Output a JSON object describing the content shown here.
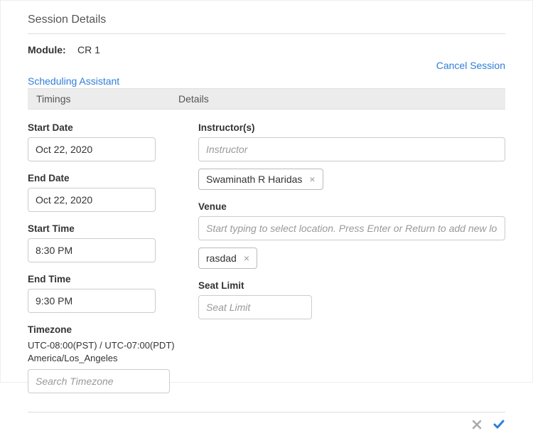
{
  "header": {
    "title": "Session Details",
    "module_label": "Module:",
    "module_value": "CR 1",
    "cancel_session": "Cancel Session",
    "scheduling_assistant": "Scheduling Assistant"
  },
  "tabs": {
    "timings": "Timings",
    "details": "Details"
  },
  "timings": {
    "start_date_label": "Start Date",
    "start_date_value": "Oct 22, 2020",
    "end_date_label": "End Date",
    "end_date_value": "Oct 22, 2020",
    "start_time_label": "Start Time",
    "start_time_value": "8:30 PM",
    "end_time_label": "End Time",
    "end_time_value": "9:30 PM",
    "timezone_label": "Timezone",
    "timezone_value": "UTC-08:00(PST) / UTC-07:00(PDT) America/Los_Angeles",
    "timezone_placeholder": "Search Timezone"
  },
  "details": {
    "instructor_label": "Instructor(s)",
    "instructor_placeholder": "Instructor",
    "instructor_chips": [
      "Swaminath R Haridas"
    ],
    "venue_label": "Venue",
    "venue_placeholder": "Start typing to select location. Press Enter or Return to add new location",
    "venue_chips": [
      "rasdad"
    ],
    "seat_limit_label": "Seat Limit",
    "seat_limit_placeholder": "Seat Limit"
  }
}
